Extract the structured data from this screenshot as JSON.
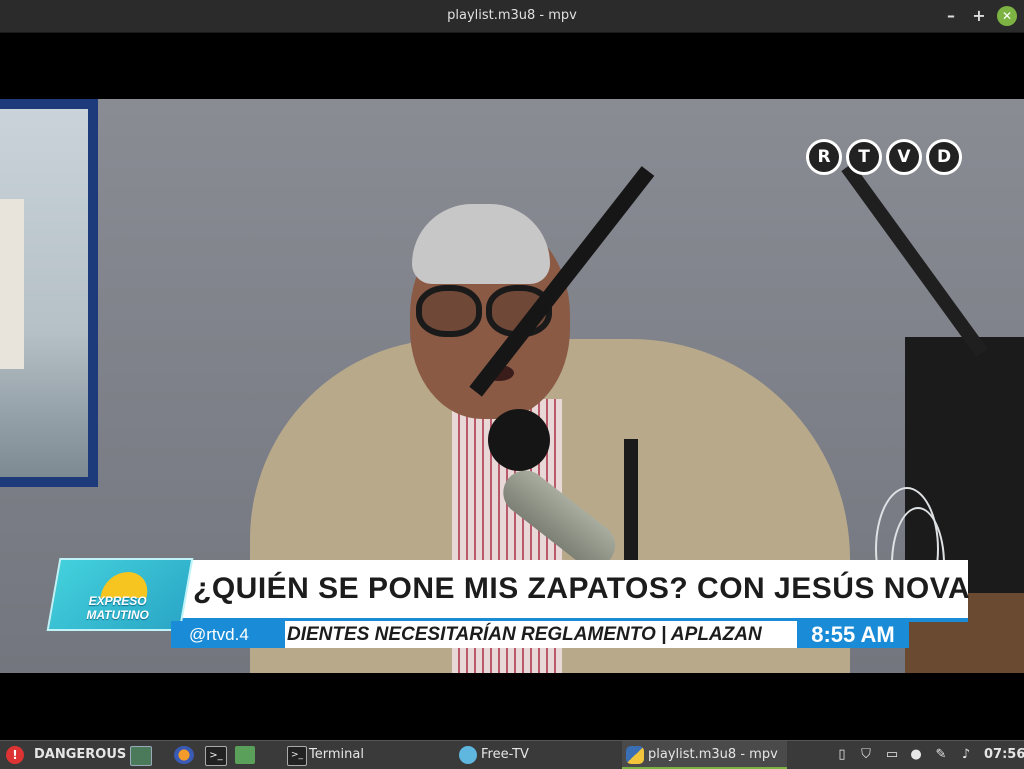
{
  "window": {
    "title": "playlist.m3u8 - mpv",
    "minimize_label": "–",
    "maximize_label": "+",
    "close_label": "✕"
  },
  "video": {
    "channel_logo": [
      "R",
      "T",
      "V",
      "D"
    ],
    "show_logo_text": "EXPRESO MATUTINO",
    "headline": "¿QUIÉN SE PONE MIS ZAPATOS? CON JESÚS NOVA",
    "handle": "@rtvd.4",
    "ticker": "DIENTES NECESITARÍAN REGLAMENTO | APLAZAN",
    "clock": "8:55 AM"
  },
  "taskbar": {
    "menu_label": "DANGEROUS",
    "launchers": [
      "terminal-launcher-icon",
      "firefox-icon",
      "terminal-icon",
      "files-icon"
    ],
    "tasks": [
      {
        "label": "Terminal",
        "icon": "terminal-icon"
      },
      {
        "label": "Free-TV",
        "icon": "free-tv-icon"
      },
      {
        "label": "playlist.m3u8 - mpv",
        "icon": "python-icon"
      }
    ],
    "tray_icons": [
      "clipboard-icon",
      "shield-icon",
      "display-icon",
      "user-icon",
      "pen-icon",
      "volume-icon"
    ],
    "clock": "07:56",
    "accent_color": "#7db343"
  }
}
